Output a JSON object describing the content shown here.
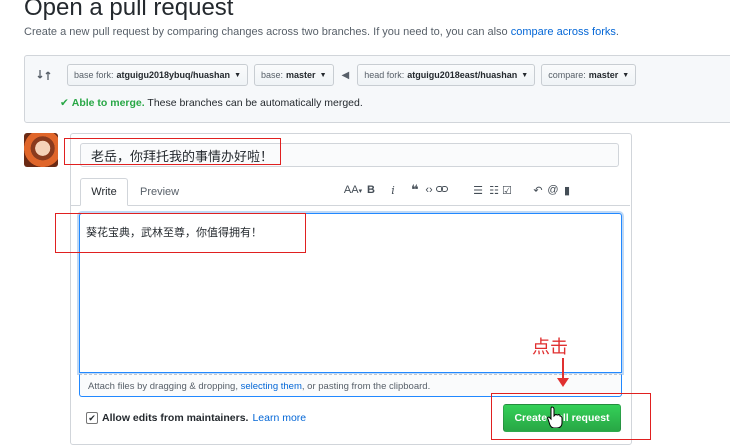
{
  "header": {
    "title": "Open a pull request",
    "subtitle": "Create a new pull request by comparing changes across two branches. If you need to, you can also ",
    "subtitle_link": "compare across forks",
    "subtitle_end": "."
  },
  "compare": {
    "base_fork_label": "base fork:",
    "base_fork_value": "atguigu2018ybuq/huashan",
    "base_label": "base:",
    "base_value": "master",
    "head_fork_label": "head fork:",
    "head_fork_value": "atguigu2018east/huashan",
    "compare_label": "compare:",
    "compare_value": "master",
    "merge_status": "Able to merge.",
    "merge_detail": " These branches can be automatically merged."
  },
  "form": {
    "title_value": "老岳，你拜托我的事情办好啦！",
    "tabs": {
      "write": "Write",
      "preview": "Preview"
    },
    "toolbar": [
      "AA",
      "B",
      "i",
      "❝",
      "‹›",
      "🔗",
      "☰",
      "☷",
      "☑",
      "↶",
      "@",
      "▮"
    ],
    "body_value": "葵花宝典，武林至尊，你值得拥有！",
    "attach_text_1": "Attach files by dragging & dropping, ",
    "attach_link": "selecting them",
    "attach_text_2": ", or pasting from the clipboard.",
    "allow_label": "Allow edits from maintainers.",
    "learn_more": "Learn more",
    "create_button": "Create pull request"
  },
  "annotation": {
    "text": "点击",
    "color": "#e03030"
  },
  "colors": {
    "accent": "#0366d6",
    "success": "#28a745",
    "annotation_red": "#e02020"
  }
}
